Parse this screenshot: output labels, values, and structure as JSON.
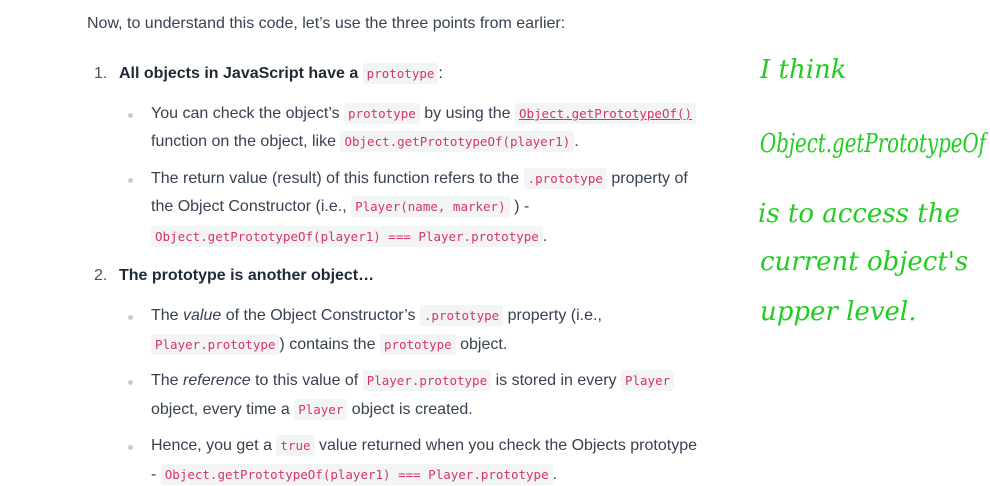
{
  "intro": "Now, to understand this code, let’s use the three points from earlier:",
  "items": [
    {
      "number": "1.",
      "heading": "All objects in JavaScript have a",
      "heading_code": "prototype",
      "heading_tail": ":",
      "bullets": [
        {
          "l1a": "You can check the object’s",
          "l1code": "prototype",
          "l1b": "by using the",
          "l1link": "Object.getPrototypeOf()",
          "l2a": "function on the object, like",
          "l2code": "Object.getPrototypeOf(player1)",
          "l2b": "."
        },
        {
          "l1a": "The return value (result) of this function refers to the",
          "l1code": ".prototype",
          "l1b": "property of",
          "l2a": "the Object Constructor (i.e.,",
          "l2code": "Player(name, marker)",
          "l2b": ") -",
          "l3code": "Object.getPrototypeOf(player1) === Player.prototype",
          "l3b": "."
        }
      ]
    },
    {
      "number": "2.",
      "heading": "The prototype is another object…",
      "bullets": [
        {
          "l1a": "The",
          "l1em": "value",
          "l1b": "of the Object Constructor’s",
          "l1code": ".prototype",
          "l1c": "property (i.e.,",
          "l2code": "Player.prototype",
          "l2a": ") contains the",
          "l2code2": "prototype",
          "l2b": "object."
        },
        {
          "l1a": "The",
          "l1em": "reference",
          "l1b": "to this value of",
          "l1code": "Player.prototype",
          "l1c": "is stored in every",
          "l1code2": "Player",
          "l2a": "object, every time a",
          "l2code": "Player",
          "l2b": "object is created."
        },
        {
          "l1a": "Hence, you get a",
          "l1code": "true",
          "l1b": "value returned when you check the Objects prototype",
          "l2a": "-",
          "l2code": "Object.getPrototypeOf(player1) === Player.prototype",
          "l2b": "."
        }
      ]
    }
  ],
  "handwritten_note": [
    "I think",
    "Object.getPrototypeOf",
    "is to access the",
    "current object's",
    "upper level."
  ],
  "colors": {
    "code_text": "#d6336c",
    "code_bg": "#f3f4f6",
    "note_ink": "#1fce1f"
  }
}
